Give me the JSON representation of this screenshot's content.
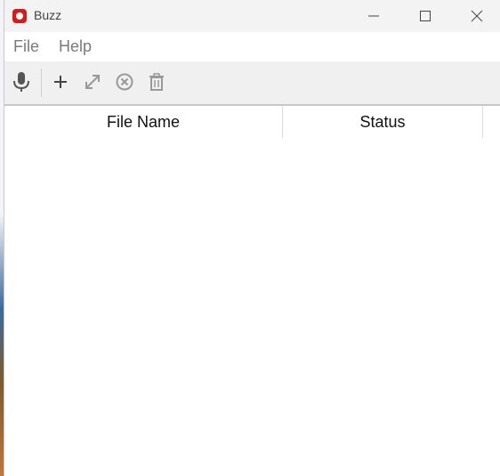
{
  "window": {
    "title": "Buzz",
    "controls": [
      "minimize-icon",
      "maximize-icon",
      "close-icon"
    ]
  },
  "menu": {
    "items": [
      {
        "label": "File"
      },
      {
        "label": "Help"
      }
    ]
  },
  "toolbar": {
    "buttons": [
      {
        "icon": "microphone-icon",
        "label": "Record"
      },
      {
        "icon": "plus-icon",
        "label": "New transcription"
      },
      {
        "icon": "expand-icon",
        "label": "Open transcript"
      },
      {
        "icon": "cancel-circle-icon",
        "label": "Stop transcription"
      },
      {
        "icon": "trash-icon",
        "label": "Clear history"
      }
    ]
  },
  "table": {
    "columns": [
      "File Name",
      "Status"
    ],
    "rows": []
  }
}
